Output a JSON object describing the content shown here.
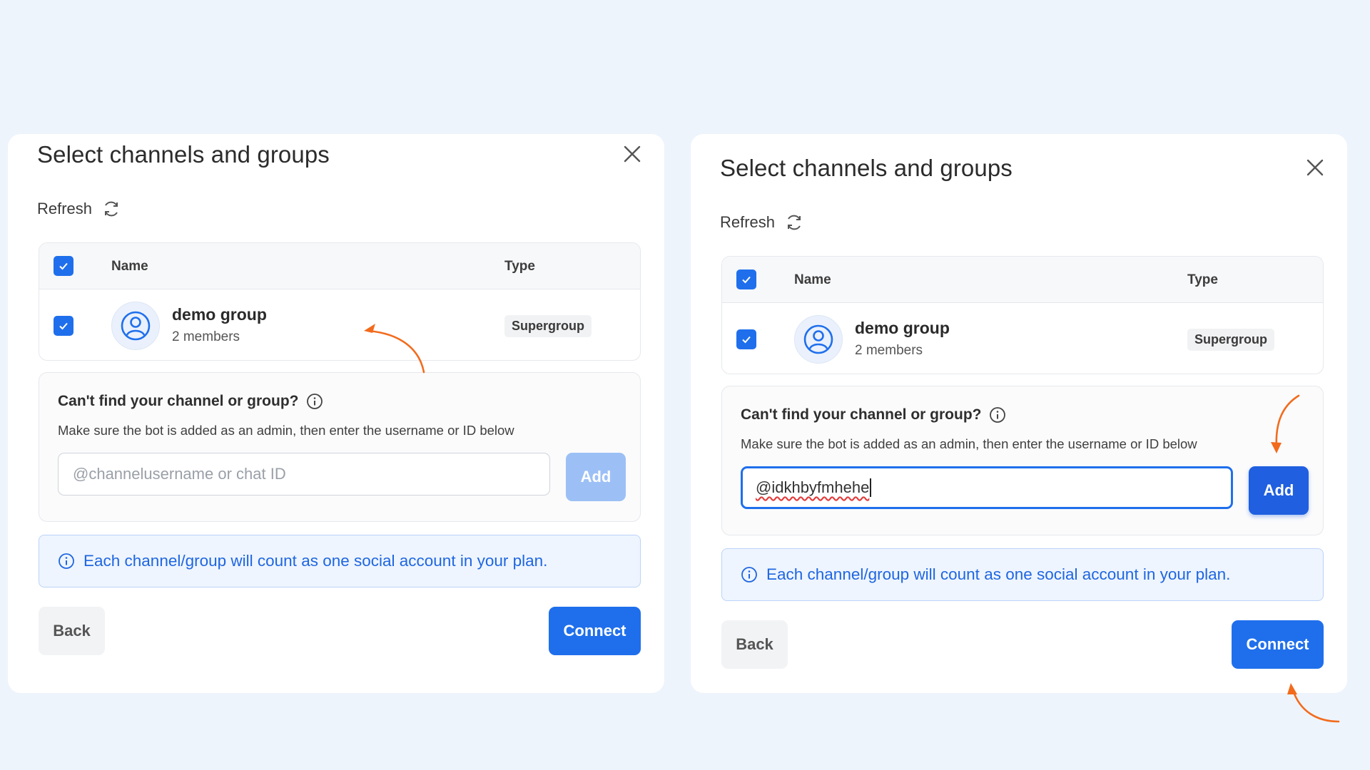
{
  "colors": {
    "background": "#eef4fc",
    "primary": "#1f6fec",
    "annotation_arrow": "#f26b1d"
  },
  "dialogs": [
    {
      "title": "Select channels and groups",
      "refresh_label": "Refresh",
      "table": {
        "headers": [
          "Name",
          "Type"
        ],
        "select_all_checked": true,
        "rows": [
          {
            "name": "demo group",
            "members": "2 members",
            "type": "Supergroup",
            "checked": true
          }
        ]
      },
      "find": {
        "title": "Can't find your channel or group?",
        "description": "Make sure the bot is added as an admin, then enter the username or ID below",
        "input_placeholder": "@channelusername or chat ID",
        "input_value": "",
        "add_label": "Add",
        "add_enabled": false
      },
      "notice": "Each channel/group will count as one social account in your plan.",
      "back_label": "Back",
      "connect_label": "Connect"
    },
    {
      "title": "Select channels and groups",
      "refresh_label": "Refresh",
      "table": {
        "headers": [
          "Name",
          "Type"
        ],
        "select_all_checked": true,
        "rows": [
          {
            "name": "demo group",
            "members": "2 members",
            "type": "Supergroup",
            "checked": true
          }
        ]
      },
      "find": {
        "title": "Can't find your channel or group?",
        "description": "Make sure the bot is added as an admin, then enter the username or ID below",
        "input_placeholder": "@channelusername or chat ID",
        "input_value": "@idkhbyfmhehe",
        "add_label": "Add",
        "add_enabled": true
      },
      "notice": "Each channel/group will count as one social account in your plan.",
      "back_label": "Back",
      "connect_label": "Connect"
    }
  ]
}
